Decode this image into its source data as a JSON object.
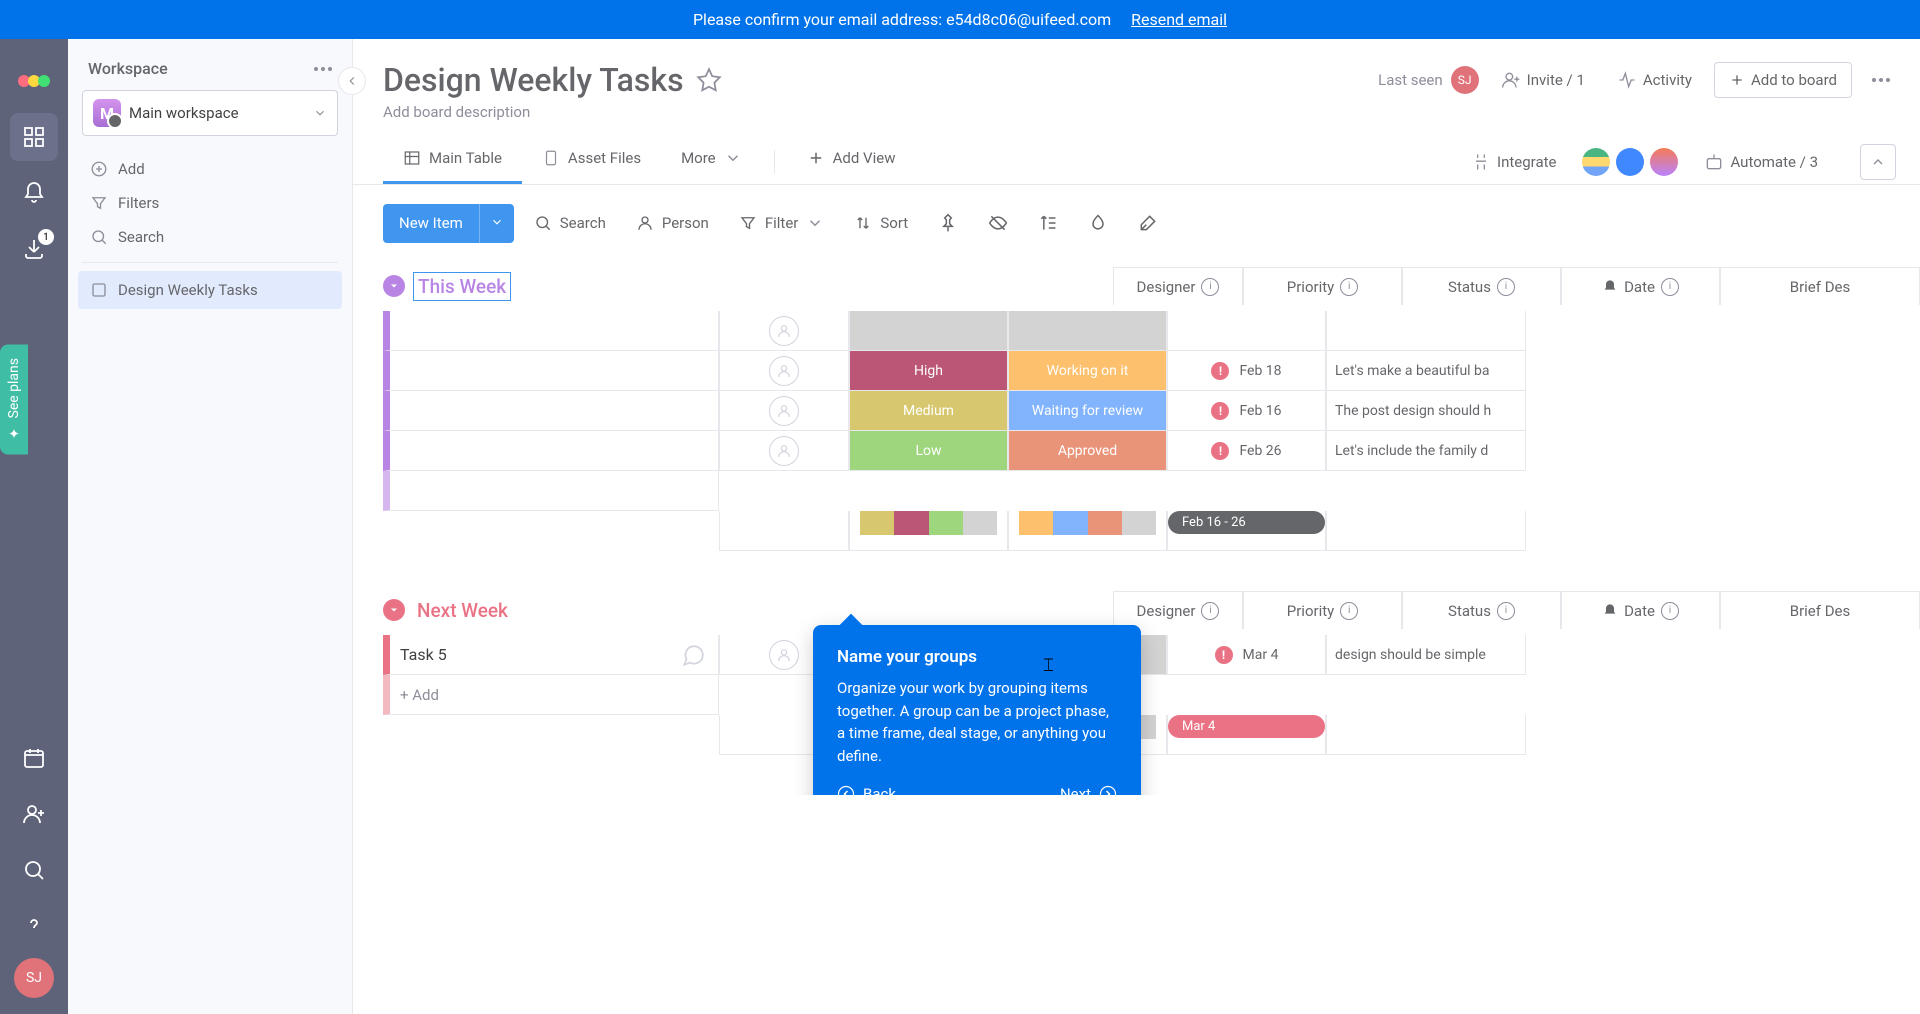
{
  "banner": {
    "text": "Please confirm your email address: e54d8c06@uifeed.com",
    "resend": "Resend email"
  },
  "rail": {
    "badge": "1",
    "avatar": "SJ"
  },
  "see_plans": "See plans",
  "sidebar": {
    "title": "Workspace",
    "workspace_label": "Main workspace",
    "workspace_initial": "M",
    "add": "Add",
    "filters": "Filters",
    "search": "Search",
    "board": "Design Weekly Tasks"
  },
  "header": {
    "title": "Design Weekly Tasks",
    "desc": "Add board description",
    "last_seen": "Last seen",
    "last_seen_av": "SJ",
    "invite": "Invite / 1",
    "activity": "Activity",
    "add_to_board": "Add to board"
  },
  "tabs": {
    "main_table": "Main Table",
    "asset_files": "Asset Files",
    "more": "More",
    "add_view": "Add View",
    "integrate": "Integrate",
    "automate": "Automate / 3"
  },
  "toolbar": {
    "new_item": "New Item",
    "search": "Search",
    "person": "Person",
    "filter": "Filter",
    "sort": "Sort"
  },
  "columns": {
    "designer": "Designer",
    "priority": "Priority",
    "status": "Status",
    "date": "Date",
    "brief": "Brief Des"
  },
  "groups": {
    "this_week": {
      "title": "This Week",
      "rows": [
        {
          "priority": "",
          "priority_color": "#c4c4c4",
          "status": "",
          "status_color": "#c4c4c4",
          "date": "",
          "brief": ""
        },
        {
          "priority": "High",
          "priority_color": "#a61e49",
          "status": "Working on it",
          "status_color": "#fdab3d",
          "date": "Feb 18",
          "brief": "Let's make a beautiful ba"
        },
        {
          "priority": "Medium",
          "priority_color": "#cab641",
          "status": "Waiting for review",
          "status_color": "#579bfc",
          "date": "Feb 16",
          "brief": "The post design should h"
        },
        {
          "priority": "Low",
          "priority_color": "#7dc850",
          "status": "Approved",
          "status_color": "#e2714c",
          "date": "Feb 26",
          "brief": "Let's include the family d"
        }
      ],
      "summary_date": "Feb 16 - 26"
    },
    "next_week": {
      "title": "Next Week",
      "rows": [
        {
          "task": "Task 5",
          "date": "Mar 4",
          "brief": "design should be simple"
        }
      ],
      "add": "+ Add",
      "summary_date": "Mar 4"
    }
  },
  "tooltip": {
    "title": "Name your groups",
    "body": "Organize your work by grouping items together. A group can be a project phase, a time frame, deal stage, or anything you define.",
    "back": "Back",
    "next": "Next"
  }
}
